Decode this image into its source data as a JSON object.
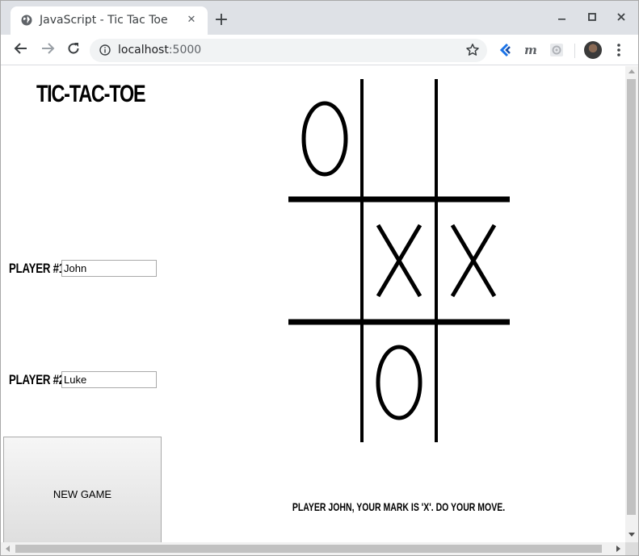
{
  "browser": {
    "tab_title": "JavaScript - Tic Tac Toe",
    "close_glyph": "✕",
    "new_tab_glyph": "+",
    "url_host": "localhost",
    "url_port": ":5000",
    "window_controls": {
      "minimize": "—",
      "maximize": "☐",
      "close": "✕"
    },
    "nav": {
      "back": "←",
      "forward": "→",
      "reload": "↻"
    }
  },
  "page": {
    "title": "TIC-TAC-TOE",
    "player1": {
      "label": "PLAYER #1:",
      "value": "John"
    },
    "player2": {
      "label": "PLAYER #2:",
      "value": "Luke"
    },
    "new_game_label": "NEW GAME",
    "status": "PLAYER JOHN, YOUR MARK IS 'X'. DO YOUR MOVE."
  },
  "board": {
    "cells": [
      "O",
      "",
      "",
      "",
      "X",
      "X",
      "",
      "O",
      ""
    ]
  }
}
